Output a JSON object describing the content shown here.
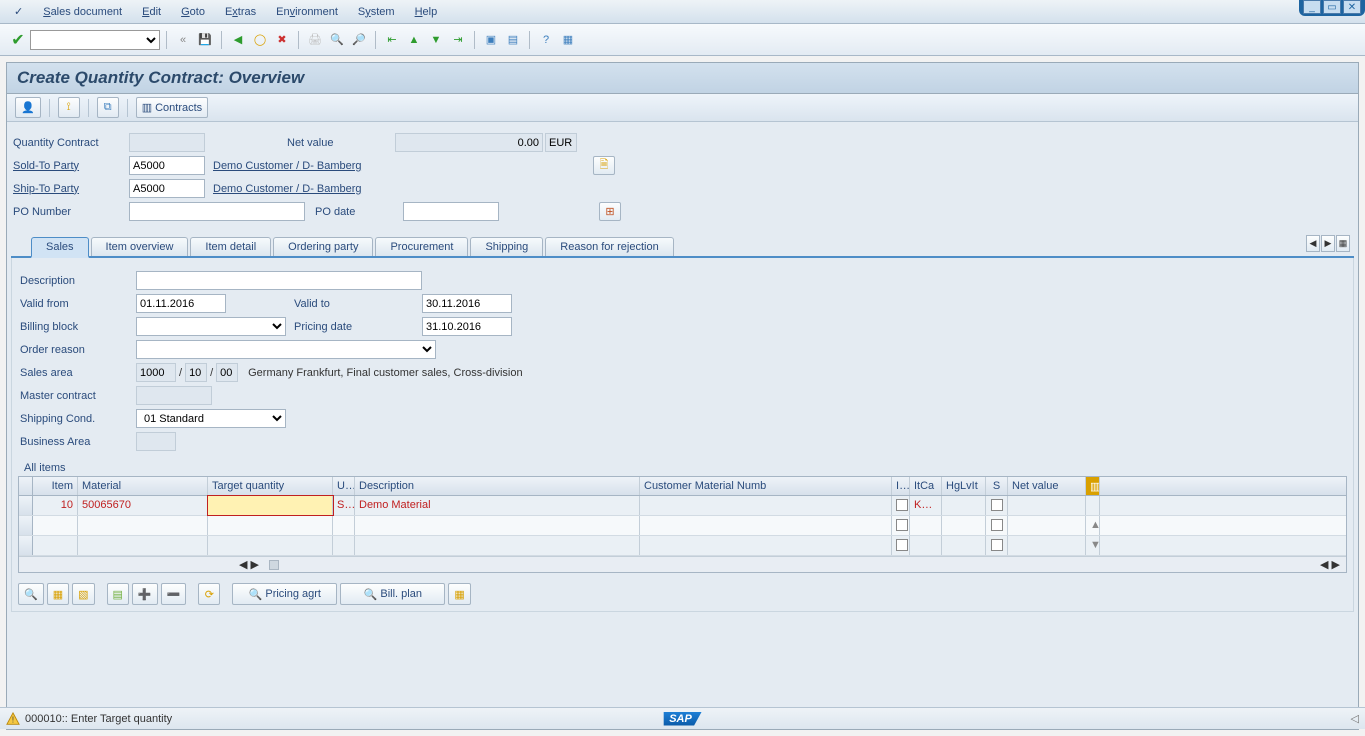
{
  "menubar": {
    "doc_icon": "📄",
    "items": [
      "Sales document",
      "Edit",
      "Goto",
      "Extras",
      "Environment",
      "System",
      "Help"
    ]
  },
  "title": "Create Quantity Contract: Overview",
  "subtoolbar": {
    "contracts_label": "Contracts"
  },
  "header": {
    "qc_label": "Quantity Contract",
    "qc_value": "",
    "netvalue_label": "Net value",
    "netvalue_value": "0.00",
    "currency": "EUR",
    "soldto_label": "Sold-To Party",
    "soldto_value": "A5000",
    "soldto_text": "Demo Customer / D- Bamberg",
    "shipto_label": "Ship-To Party",
    "shipto_value": "A5000",
    "shipto_text": "Demo Customer / D- Bamberg",
    "po_label": "PO Number",
    "po_value": "",
    "podate_label": "PO date",
    "podate_value": ""
  },
  "tabs": [
    "Sales",
    "Item overview",
    "Item detail",
    "Ordering party",
    "Procurement",
    "Shipping",
    "Reason for rejection"
  ],
  "active_tab": 0,
  "sales": {
    "desc_label": "Description",
    "desc_value": "",
    "validfrom_label": "Valid from",
    "validfrom_value": "01.11.2016",
    "validto_label": "Valid to",
    "validto_value": "30.11.2016",
    "billblock_label": "Billing block",
    "billblock_value": "",
    "pricedate_label": "Pricing date",
    "pricedate_value": "31.10.2016",
    "orderreason_label": "Order reason",
    "orderreason_value": "",
    "salesarea_label": "Sales area",
    "salesarea_v1": "1000",
    "salesarea_v2": "10",
    "salesarea_v3": "00",
    "salesarea_text": "Germany Frankfurt, Final customer sales, Cross-division",
    "master_label": "Master contract",
    "master_value": "",
    "shipcond_label": "Shipping Cond.",
    "shipcond_value": "01 Standard",
    "busarea_label": "Business Area",
    "busarea_value": ""
  },
  "items_title": "All items",
  "grid": {
    "cols": [
      "Item",
      "Material",
      "Target quantity",
      "U...",
      "Description",
      "Customer Material Numb",
      "I...",
      "ItCa",
      "HgLvIt",
      "S",
      "Net value"
    ],
    "rows": [
      {
        "item": "10",
        "material": "50065670",
        "tq": "",
        "um": "ST",
        "desc": "Demo Material",
        "cust": "",
        "i": false,
        "itca": "KMN",
        "hgl": "",
        "s": false,
        "net": ""
      },
      {
        "item": "",
        "material": "",
        "tq": "",
        "um": "",
        "desc": "",
        "cust": "",
        "i": false,
        "itca": "",
        "hgl": "",
        "s": false,
        "net": ""
      },
      {
        "item": "",
        "material": "",
        "tq": "",
        "um": "",
        "desc": "",
        "cust": "",
        "i": false,
        "itca": "",
        "hgl": "",
        "s": false,
        "net": ""
      }
    ]
  },
  "footer": {
    "pricing_label": "Pricing agrt",
    "billplan_label": "Bill. plan"
  },
  "status": {
    "message": "000010:: Enter Target quantity",
    "sap_logo": "SAP"
  }
}
